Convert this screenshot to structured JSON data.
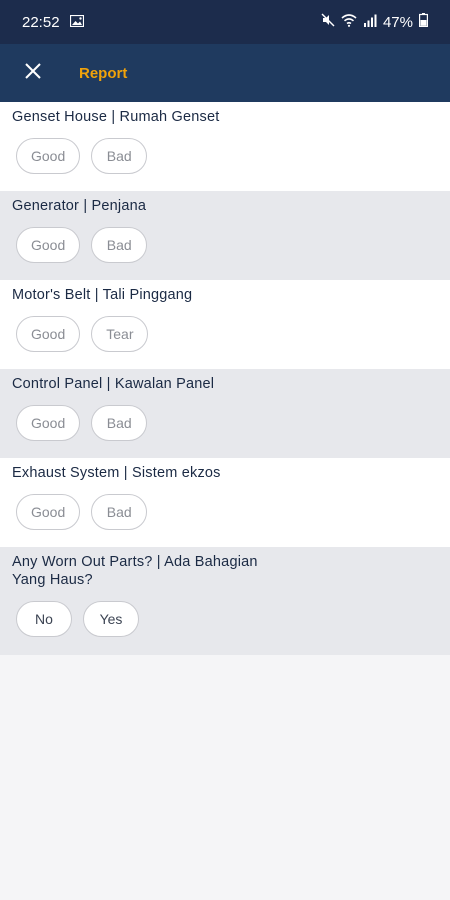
{
  "status_bar": {
    "time": "22:52",
    "battery": "47%"
  },
  "app_bar": {
    "title": "Report"
  },
  "sections": [
    {
      "question": "Genset House | Rumah Genset",
      "options": [
        "Good",
        "Bad"
      ]
    },
    {
      "question": "Generator | Penjana",
      "options": [
        "Good",
        "Bad"
      ]
    },
    {
      "question": "Motor's Belt | Tali Pinggang",
      "options": [
        "Good",
        "Tear"
      ]
    },
    {
      "question": "Control Panel | Kawalan Panel",
      "options": [
        "Good",
        "Bad"
      ]
    },
    {
      "question": "Exhaust System | Sistem ekzos",
      "options": [
        "Good",
        "Bad"
      ]
    },
    {
      "question": "Any Worn Out Parts? | Ada Bahagian Yang Haus?",
      "options": [
        "No",
        "Yes"
      ]
    }
  ],
  "colors": {
    "status_bar": "#1c2c4c",
    "app_bar": "#1f3a5f",
    "title": "#f0a20a",
    "section_alt": "#e7e8ec"
  }
}
